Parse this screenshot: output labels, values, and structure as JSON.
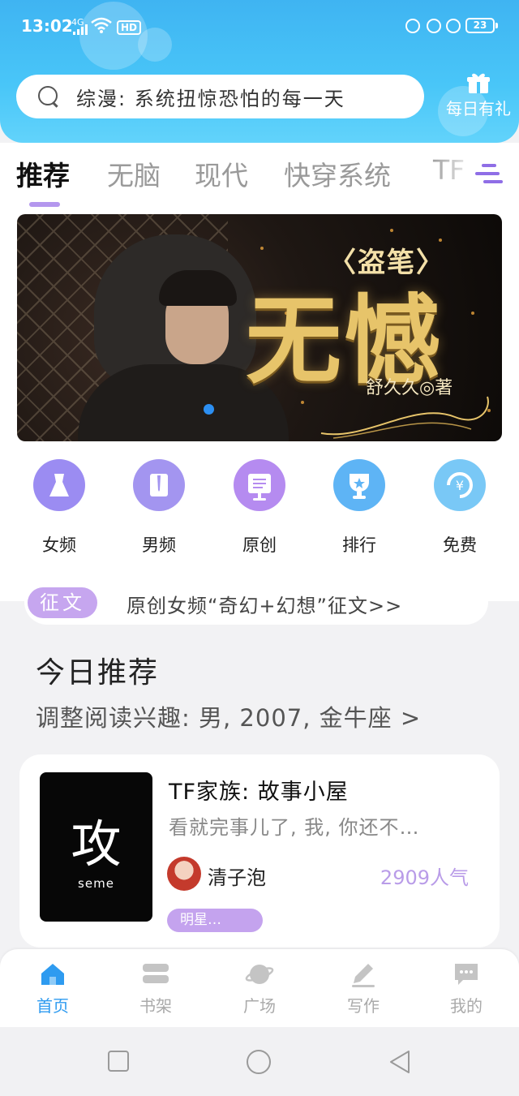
{
  "status_bar": {
    "time": "13:02",
    "network": "4G",
    "hd": "HD",
    "battery": "23"
  },
  "search": {
    "prefix": "综漫:",
    "placeholder": "系统扭惊恐怕的每一天"
  },
  "daily_gift": {
    "label": "每日有礼"
  },
  "tabs": [
    {
      "label": "推荐",
      "active": true
    },
    {
      "label": "无脑"
    },
    {
      "label": "现代"
    },
    {
      "label": "快穿系统"
    },
    {
      "label": "TF"
    }
  ],
  "banner": {
    "subtitle": "〈盗笔〉",
    "title": "无憾",
    "author": "舒久久◎著"
  },
  "categories": [
    {
      "label": "女频",
      "icon": "dress-icon",
      "color": "#9b8cf2"
    },
    {
      "label": "男频",
      "icon": "shirt-icon",
      "color": "#a395f0"
    },
    {
      "label": "原创",
      "icon": "book-icon",
      "color": "#b58bf0"
    },
    {
      "label": "排行",
      "icon": "trophy-icon",
      "color": "#5eb4f5"
    },
    {
      "label": "免费",
      "icon": "yuan-icon",
      "color": "#79c8f6"
    }
  ],
  "contest": {
    "badge": "征文",
    "text": "原创女频“奇幻+幻想”征文>>"
  },
  "today": {
    "title": "今日推荐",
    "subtitle": "调整阅读兴趣: 男, 2007, 金牛座 >"
  },
  "book": {
    "cover_char": "攻",
    "cover_word": "seme",
    "title": "TF家族: 故事小屋",
    "desc": "看就完事儿了, 我, 你还不…",
    "author": "清子泡",
    "popularity": "2909人气",
    "tag": "明星…"
  },
  "bottom_nav": [
    {
      "label": "首页",
      "icon": "home-icon",
      "active": true
    },
    {
      "label": "书架",
      "icon": "bookshelf-icon"
    },
    {
      "label": "广场",
      "icon": "planet-icon"
    },
    {
      "label": "写作",
      "icon": "pen-icon"
    },
    {
      "label": "我的",
      "icon": "chat-icon"
    }
  ],
  "colors": {
    "header_top": "#3fb4f2",
    "accent_purple": "#b497ee",
    "active_blue": "#2e9bf0"
  }
}
